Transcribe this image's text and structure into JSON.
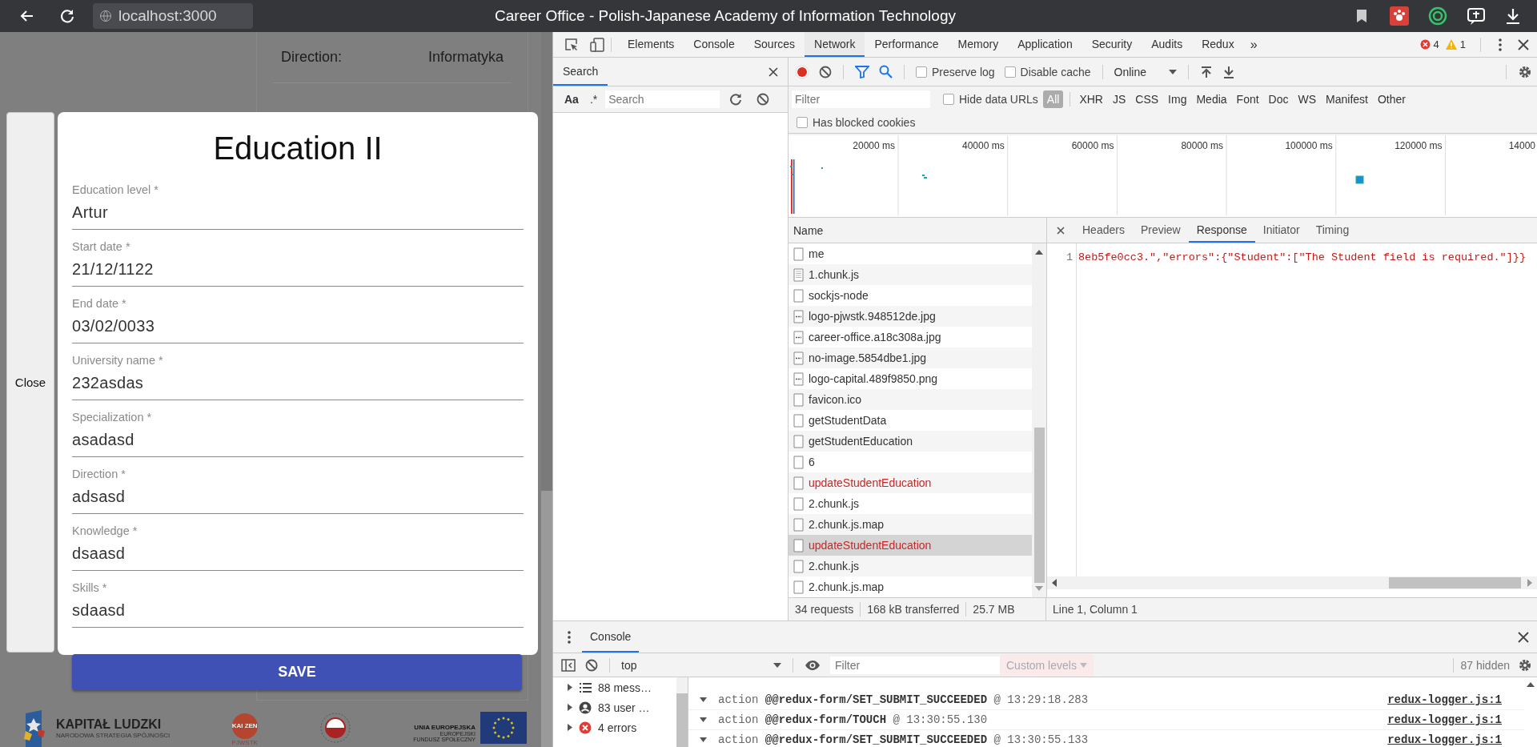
{
  "browser": {
    "url": "localhost:3000",
    "title": "Career Office - Polish-Japanese Academy of Information Technology"
  },
  "page": {
    "details": [
      {
        "label": "Direction:",
        "value": "Informatyka"
      }
    ],
    "footer": {
      "kapital_title": "KAPITAŁ LUDZKI",
      "kapital_subtitle": "NARODOWA STRATEGIA SPÓJNOŚCI",
      "kaizen": "KAI ZEN",
      "pjwstk": "PJWSTK",
      "eu_title": "UNIA EUROPEJSKA",
      "eu_line_1": "EUROPEJSKI",
      "eu_line_2": "FUNDUSZ SPOŁECZNY"
    }
  },
  "modal": {
    "close": "Close",
    "title": "Education II",
    "save": "SAVE",
    "fields": [
      {
        "label": "Education level *",
        "value": "Artur"
      },
      {
        "label": "Start date *",
        "value": "21/12/1122"
      },
      {
        "label": "End date *",
        "value": "03/02/0033"
      },
      {
        "label": "University name *",
        "value": "232asdas"
      },
      {
        "label": "Specialization *",
        "value": "asadasd"
      },
      {
        "label": "Direction *",
        "value": "adsasd"
      },
      {
        "label": "Knowledge *",
        "value": "dsaasd"
      },
      {
        "label": "Skills *",
        "value": "sdaasd"
      }
    ]
  },
  "devtools": {
    "tabs": [
      {
        "label": "Elements",
        "selected": false
      },
      {
        "label": "Console",
        "selected": false
      },
      {
        "label": "Sources",
        "selected": false
      },
      {
        "label": "Network",
        "selected": true
      },
      {
        "label": "Performance",
        "selected": false
      },
      {
        "label": "Memory",
        "selected": false
      },
      {
        "label": "Application",
        "selected": false
      },
      {
        "label": "Security",
        "selected": false
      },
      {
        "label": "Audits",
        "selected": false
      },
      {
        "label": "Redux",
        "selected": false
      }
    ],
    "more": "»",
    "errors": "4",
    "warnings": "1",
    "search": {
      "title": "Search",
      "match_case": "Aa",
      "regex": ".*",
      "placeholder": "Search"
    },
    "network": {
      "preserve_log": {
        "label": "Preserve log",
        "checked": false
      },
      "disable_cache": {
        "label": "Disable cache",
        "checked": false
      },
      "throttling": "Online",
      "filter_placeholder": "Filter",
      "hide_data_urls": {
        "label": "Hide data URLs",
        "checked": false
      },
      "types": [
        {
          "label": "All",
          "selected": true
        },
        {
          "label": "XHR",
          "selected": false
        },
        {
          "label": "JS",
          "selected": false
        },
        {
          "label": "CSS",
          "selected": false
        },
        {
          "label": "Img",
          "selected": false
        },
        {
          "label": "Media",
          "selected": false
        },
        {
          "label": "Font",
          "selected": false
        },
        {
          "label": "Doc",
          "selected": false
        },
        {
          "label": "WS",
          "selected": false
        },
        {
          "label": "Manifest",
          "selected": false
        },
        {
          "label": "Other",
          "selected": false
        }
      ],
      "blocked_cookies": {
        "label": "Has blocked cookies",
        "checked": false
      },
      "timeline_ticks": [
        "20000 ms",
        "40000 ms",
        "60000 ms",
        "80000 ms",
        "100000 ms",
        "120000 ms",
        "14000"
      ],
      "name_header": "Name",
      "requests": [
        {
          "name": "me",
          "kind": "doc",
          "error": false,
          "selected": false
        },
        {
          "name": "1.chunk.js",
          "kind": "script",
          "error": false,
          "selected": false
        },
        {
          "name": "sockjs-node",
          "kind": "doc",
          "error": false,
          "selected": false
        },
        {
          "name": "logo-pjwstk.948512de.jpg",
          "kind": "image",
          "error": false,
          "selected": false
        },
        {
          "name": "career-office.a18c308a.jpg",
          "kind": "image",
          "error": false,
          "selected": false
        },
        {
          "name": "no-image.5854dbe1.jpg",
          "kind": "image",
          "error": false,
          "selected": false
        },
        {
          "name": "logo-capital.489f9850.png",
          "kind": "image",
          "error": false,
          "selected": false
        },
        {
          "name": "favicon.ico",
          "kind": "doc",
          "error": false,
          "selected": false
        },
        {
          "name": "getStudentData",
          "kind": "doc",
          "error": false,
          "selected": false
        },
        {
          "name": "getStudentEducation",
          "kind": "doc",
          "error": false,
          "selected": false
        },
        {
          "name": "6",
          "kind": "doc",
          "error": false,
          "selected": false
        },
        {
          "name": "updateStudentEducation",
          "kind": "doc",
          "error": true,
          "selected": false
        },
        {
          "name": "2.chunk.js",
          "kind": "doc",
          "error": false,
          "selected": false
        },
        {
          "name": "2.chunk.js.map",
          "kind": "doc",
          "error": false,
          "selected": false
        },
        {
          "name": "updateStudentEducation",
          "kind": "doc",
          "error": true,
          "selected": true
        },
        {
          "name": "2.chunk.js",
          "kind": "doc",
          "error": false,
          "selected": false
        },
        {
          "name": "2.chunk.js.map",
          "kind": "doc",
          "error": false,
          "selected": false
        }
      ],
      "detail_tabs": [
        {
          "label": "Headers",
          "selected": false
        },
        {
          "label": "Preview",
          "selected": false
        },
        {
          "label": "Response",
          "selected": true
        },
        {
          "label": "Initiator",
          "selected": false
        },
        {
          "label": "Timing",
          "selected": false
        }
      ],
      "response": {
        "line": "1",
        "code": "8eb5fe0cc3.\",\"errors\":{\"Student\":[\"The Student field is required.\"]}}"
      },
      "summary": [
        "34 requests",
        "168 kB transferred",
        "25.7 MB"
      ],
      "cursor": "Line 1, Column 1"
    },
    "console": {
      "tab": "Console",
      "context": "top",
      "filter_placeholder": "Filter",
      "levels": "Custom levels",
      "hidden": "87 hidden",
      "sidebar": [
        {
          "kind": "messages",
          "label": "88 mess…"
        },
        {
          "kind": "user",
          "label": "83 user …"
        },
        {
          "kind": "errors",
          "label": "4 errors"
        }
      ],
      "messages": [
        {
          "prefix": "action",
          "type": "@@redux-form/SET_SUBMIT_SUCCEEDED",
          "time": "@ 13:29:18.283",
          "source": "redux-logger.js:1"
        },
        {
          "prefix": "action",
          "type": "@@redux-form/TOUCH",
          "time": "@ 13:30:55.130",
          "source": "redux-logger.js:1"
        },
        {
          "prefix": "action",
          "type": "@@redux-form/SET_SUBMIT_SUCCEEDED",
          "time": "@ 13:30:55.133",
          "source": "redux-logger.js:1"
        }
      ]
    }
  }
}
